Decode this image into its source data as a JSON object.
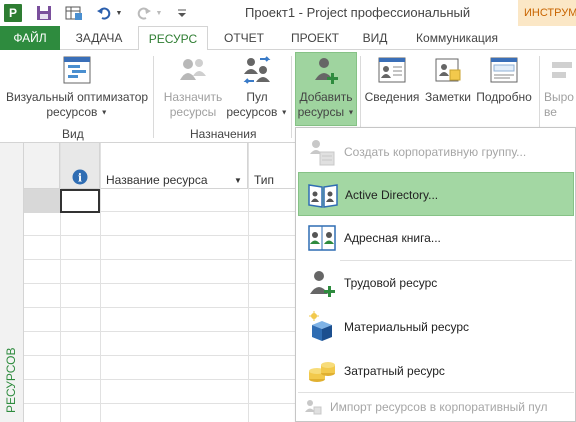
{
  "titlebar": {
    "title": "Проект1 - Project профессиональный",
    "contextual_tab": "ИНСТРУМ",
    "app_icon_letter": "P"
  },
  "tabs": [
    {
      "label": "ФАЙЛ"
    },
    {
      "label": "ЗАДАЧА"
    },
    {
      "label": "РЕСУРС"
    },
    {
      "label": "ОТЧЕТ"
    },
    {
      "label": "ПРОЕКТ"
    },
    {
      "label": "ВИД"
    },
    {
      "label": "Коммуникация"
    }
  ],
  "ribbon": {
    "visual_optimizer": {
      "line1": "Визуальный оптимизатор",
      "line2": "ресурсов"
    },
    "group_view": "Вид",
    "assign": {
      "line1": "Назначить",
      "line2": "ресурсы"
    },
    "pool": {
      "line1": "Пул",
      "line2": "ресурсов"
    },
    "group_assign": "Назначения",
    "add_resources": {
      "line1": "Добавить",
      "line2": "ресурсы"
    },
    "info": "Сведения",
    "notes": "Заметки",
    "details": "Подробно",
    "level": "Выро",
    "level2": "ве"
  },
  "grid": {
    "info_header": "i",
    "col_name": "Название ресурса",
    "col_type": "Тип",
    "side_label": "РЕСУРСОВ"
  },
  "dropdown": {
    "items": [
      {
        "label": "Создать корпоративную группу...",
        "icon": "enterprise-group-icon",
        "disabled": true
      },
      {
        "label": "Active Directory...",
        "icon": "active-directory-icon",
        "highlighted": true
      },
      {
        "label": "Адресная книга...",
        "icon": "address-book-icon"
      },
      {
        "label": "Трудовой ресурс",
        "icon": "work-resource-icon"
      },
      {
        "label": "Материальный ресурс",
        "icon": "material-resource-icon"
      },
      {
        "label": "Затратный ресурс",
        "icon": "cost-resource-icon"
      }
    ],
    "import": "Импорт ресурсов в корпоративный пул"
  },
  "colors": {
    "accent_green": "#2e8b3e",
    "highlight": "#a3d7a3",
    "contextual": "#fbe7c6"
  }
}
